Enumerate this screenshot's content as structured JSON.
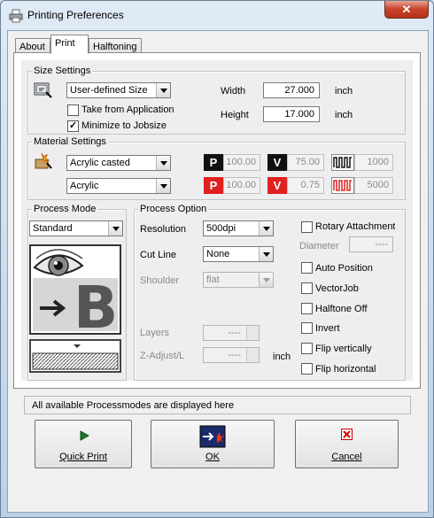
{
  "window": {
    "title": "Printing Preferences",
    "close_glyph": "✕"
  },
  "tabs": [
    {
      "label": "About"
    },
    {
      "label": "Print"
    },
    {
      "label": "Halftoning"
    }
  ],
  "size_settings": {
    "title": "Size Settings",
    "size_select": "User-defined Size",
    "take_from_application": {
      "label": "Take from Application",
      "checked": false
    },
    "minimize_to_jobsize": {
      "label": "Minimize to Jobsize",
      "checked": true
    },
    "width_label": "Width",
    "width_value": "27.000",
    "width_unit": "inch",
    "height_label": "Height",
    "height_value": "17.000",
    "height_unit": "inch"
  },
  "material_settings": {
    "title": "Material Settings",
    "material_select": "Acrylic casted",
    "submaterial_select": "Acrylic",
    "row1": {
      "p_badge": "P",
      "p_value": "100.00",
      "v_badge": "V",
      "v_value": "75.00",
      "f_value": "1000"
    },
    "row2": {
      "p_badge": "P",
      "p_value": "100.00",
      "v_badge": "V",
      "v_value": "0.75",
      "f_value": "5000"
    },
    "colors": {
      "black_badge": "#111111",
      "red_badge": "#e02020"
    }
  },
  "process_mode": {
    "title": "Process Mode",
    "mode_select": "Standard"
  },
  "process_option": {
    "title": "Process Option",
    "resolution_label": "Resolution",
    "resolution_value": "500dpi",
    "cut_line_label": "Cut Line",
    "cut_line_value": "None",
    "shoulder_label": "Shoulder",
    "shoulder_value": "flat",
    "layers_label": "Layers",
    "layers_value": "----",
    "z_adjust_label": "Z-Adjust/L",
    "z_adjust_value": "----",
    "z_adjust_unit": "inch",
    "rotary_attachment": "Rotary Attachment",
    "diameter_label": "Diameter",
    "diameter_value": "----",
    "auto_position": "Auto Position",
    "vectorjob": "VectorJob",
    "halftone_off": "Halftone Off",
    "invert": "Invert",
    "flip_vertically": "Flip vertically",
    "flip_horizontal": "Flip horizontal"
  },
  "status_text": "All available Processmodes are displayed here",
  "buttons": {
    "quick_print": "Quick Print",
    "ok": "OK",
    "cancel": "Cancel"
  }
}
